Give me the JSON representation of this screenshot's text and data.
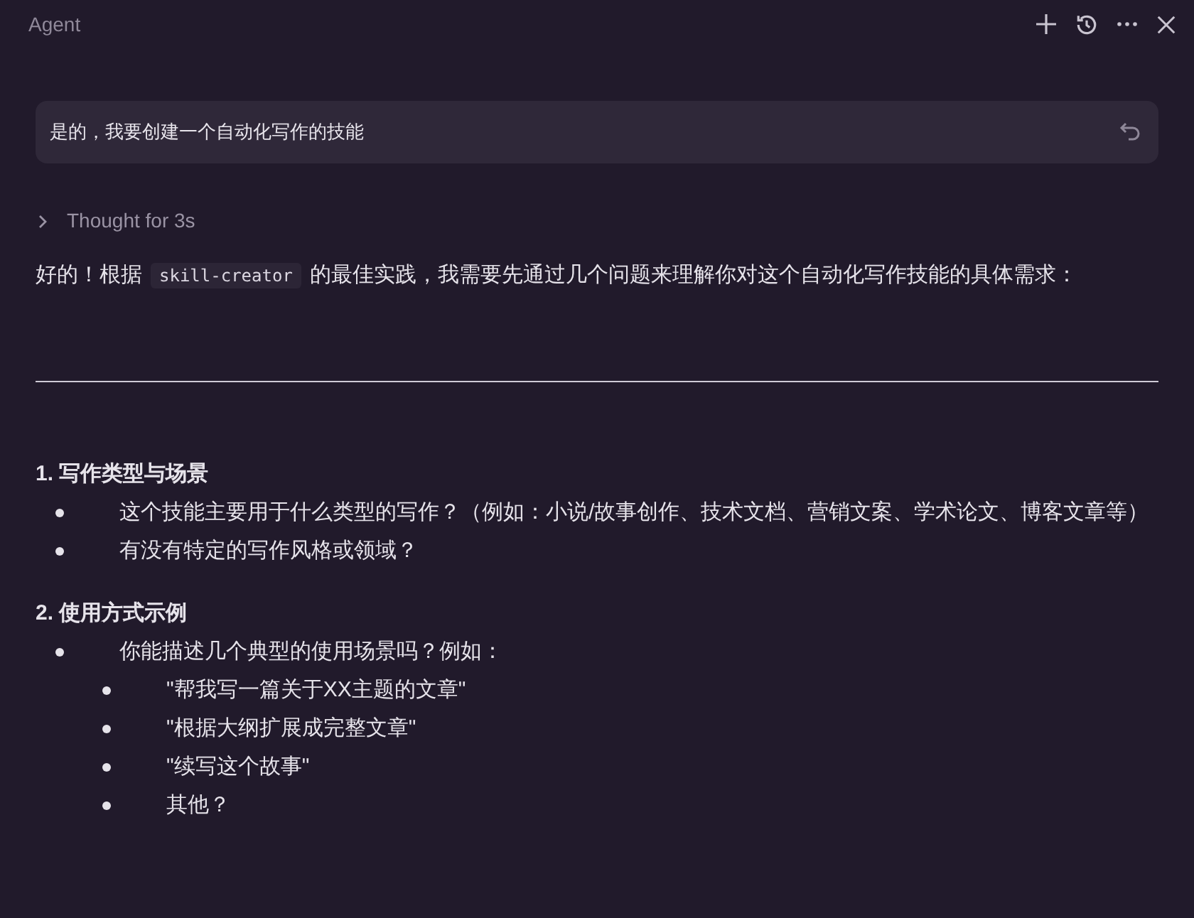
{
  "window": {
    "title": "Agent"
  },
  "user_message": "是的，我要创建一个自动化写作的技能",
  "thought": {
    "label": "Thought for 3s",
    "expanded": false
  },
  "intro": {
    "before": "好的！根据",
    "code": "skill-creator",
    "after": "的最佳实践，我需要先通过几个问题来理解你对这个自动化写作技能的具体需求："
  },
  "sections": [
    {
      "heading": "1. 写作类型与场景",
      "items": [
        {
          "text": "这个技能主要用于什么类型的写作？（例如：小说/故事创作、技术文档、营销文案、学术论文、博客文章等）"
        },
        {
          "text": "有没有特定的写作风格或领域？"
        }
      ]
    },
    {
      "heading": "2. 使用方式示例",
      "items": [
        {
          "text": "你能描述几个典型的使用场景吗？例如：",
          "children": [
            {
              "text": "\"帮我写一篇关于XX主题的文章\""
            },
            {
              "text": "\"根据大纲扩展成完整文章\""
            },
            {
              "text": "\"续写这个故事\""
            },
            {
              "text": "其他？"
            }
          ]
        }
      ]
    }
  ]
}
